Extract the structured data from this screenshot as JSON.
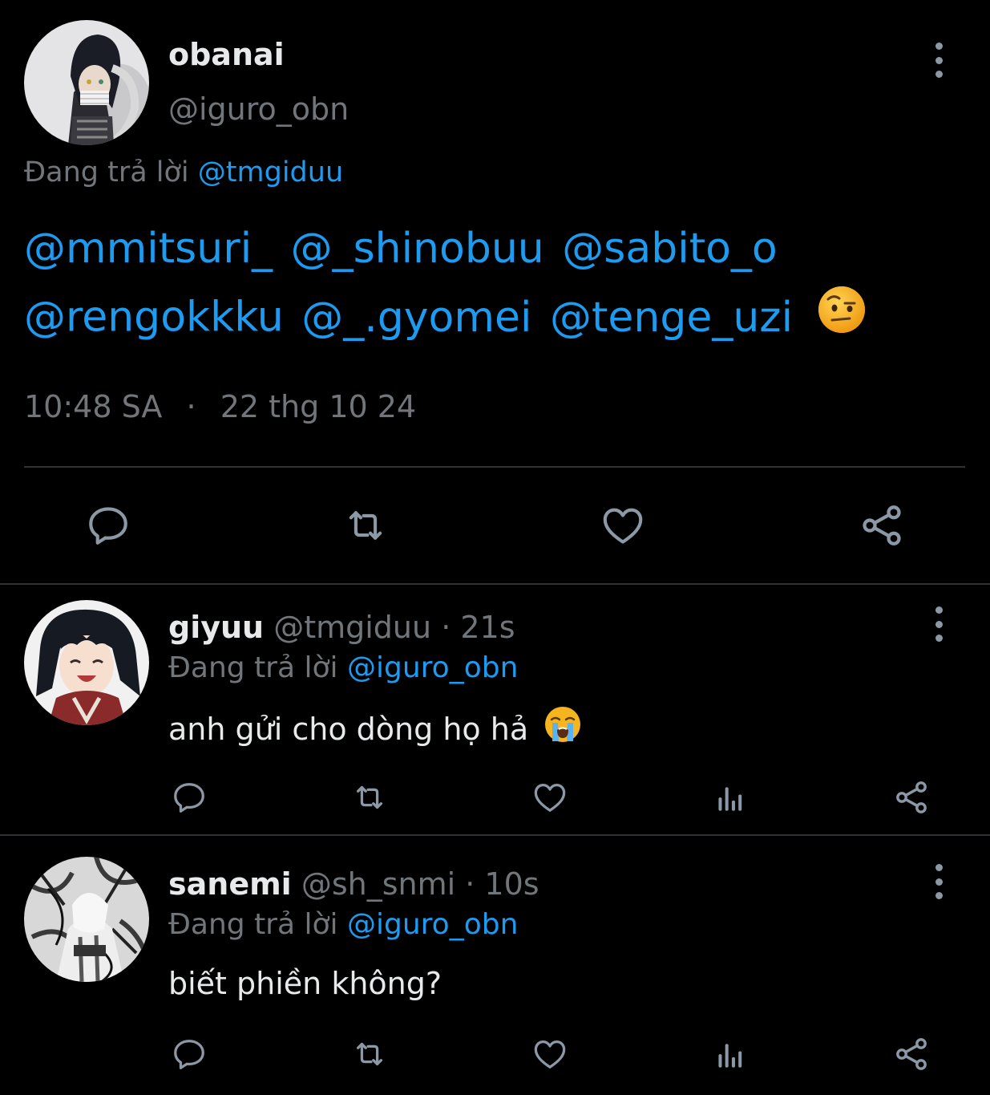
{
  "main_tweet": {
    "display_name": "obanai",
    "handle": "@iguro_obn",
    "replying_prefix": "Đang trả lời",
    "replying_to": "@tmgiduu",
    "mentions_line1": [
      "@mmitsuri_",
      "@_shinobuu",
      "@sabito_o"
    ],
    "mentions_line2": [
      "@rengokkku",
      "@_.gyomei",
      "@tenge_uzi"
    ],
    "emoji": "face-with-raised-eyebrow",
    "time": "10:48 SA",
    "separator": "·",
    "date": "22 thg 10 24",
    "actions": [
      "reply-icon",
      "retweet-icon",
      "like-icon",
      "share-icon"
    ]
  },
  "replies": [
    {
      "display_name": "giyuu",
      "handle": "@tmgiduu",
      "time": "· 21s",
      "replying_prefix": "Đang trả lời",
      "replying_to": "@iguro_obn",
      "text": "anh gửi cho dòng họ hả",
      "emoji": "loudly-crying-face",
      "actions": [
        "reply-icon",
        "retweet-icon",
        "like-icon",
        "views-icon",
        "share-icon"
      ]
    },
    {
      "display_name": "sanemi",
      "handle": "@sh_snmi",
      "time": "· 10s",
      "replying_prefix": "Đang trả lời",
      "replying_to": "@iguro_obn",
      "text": "biết phiền không?",
      "actions": [
        "reply-icon",
        "retweet-icon",
        "like-icon",
        "views-icon",
        "share-icon"
      ]
    }
  ],
  "colors": {
    "background": "#000000",
    "text": "#e7e9ea",
    "muted": "#71767b",
    "link": "#1d9bf0",
    "divider": "#2f3336",
    "icon": "#8b98a5"
  }
}
